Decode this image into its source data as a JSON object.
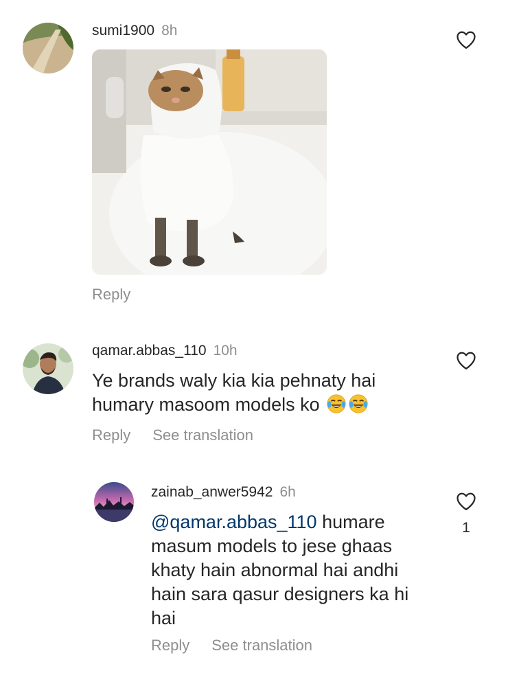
{
  "comments": [
    {
      "username": "sumi1900",
      "time": "8h",
      "reply_label": "Reply",
      "has_media": true,
      "media_icon": "cat-in-towel-photo"
    },
    {
      "username": "qamar.abbas_110",
      "time": "10h",
      "text_line1": "Ye brands waly kia kia pehnaty hai",
      "text_line2": "humary masoom models ko",
      "emojis": [
        "😂",
        "😂"
      ],
      "reply_label": "Reply",
      "translate_label": "See translation"
    }
  ],
  "reply": {
    "username": "zainab_anwer5942",
    "time": "6h",
    "mention": "@qamar.abbas_110",
    "lines": [
      " humare",
      "masum models to jese ghaas",
      "khaty hain abnormal hai andhi",
      "hain sara qasur designers ka hi",
      "hai"
    ],
    "reply_label": "Reply",
    "translate_label": "See translation",
    "like_count": "1"
  },
  "colors": {
    "text": "#262626",
    "muted": "#8e8e8e",
    "mention": "#00376b"
  }
}
